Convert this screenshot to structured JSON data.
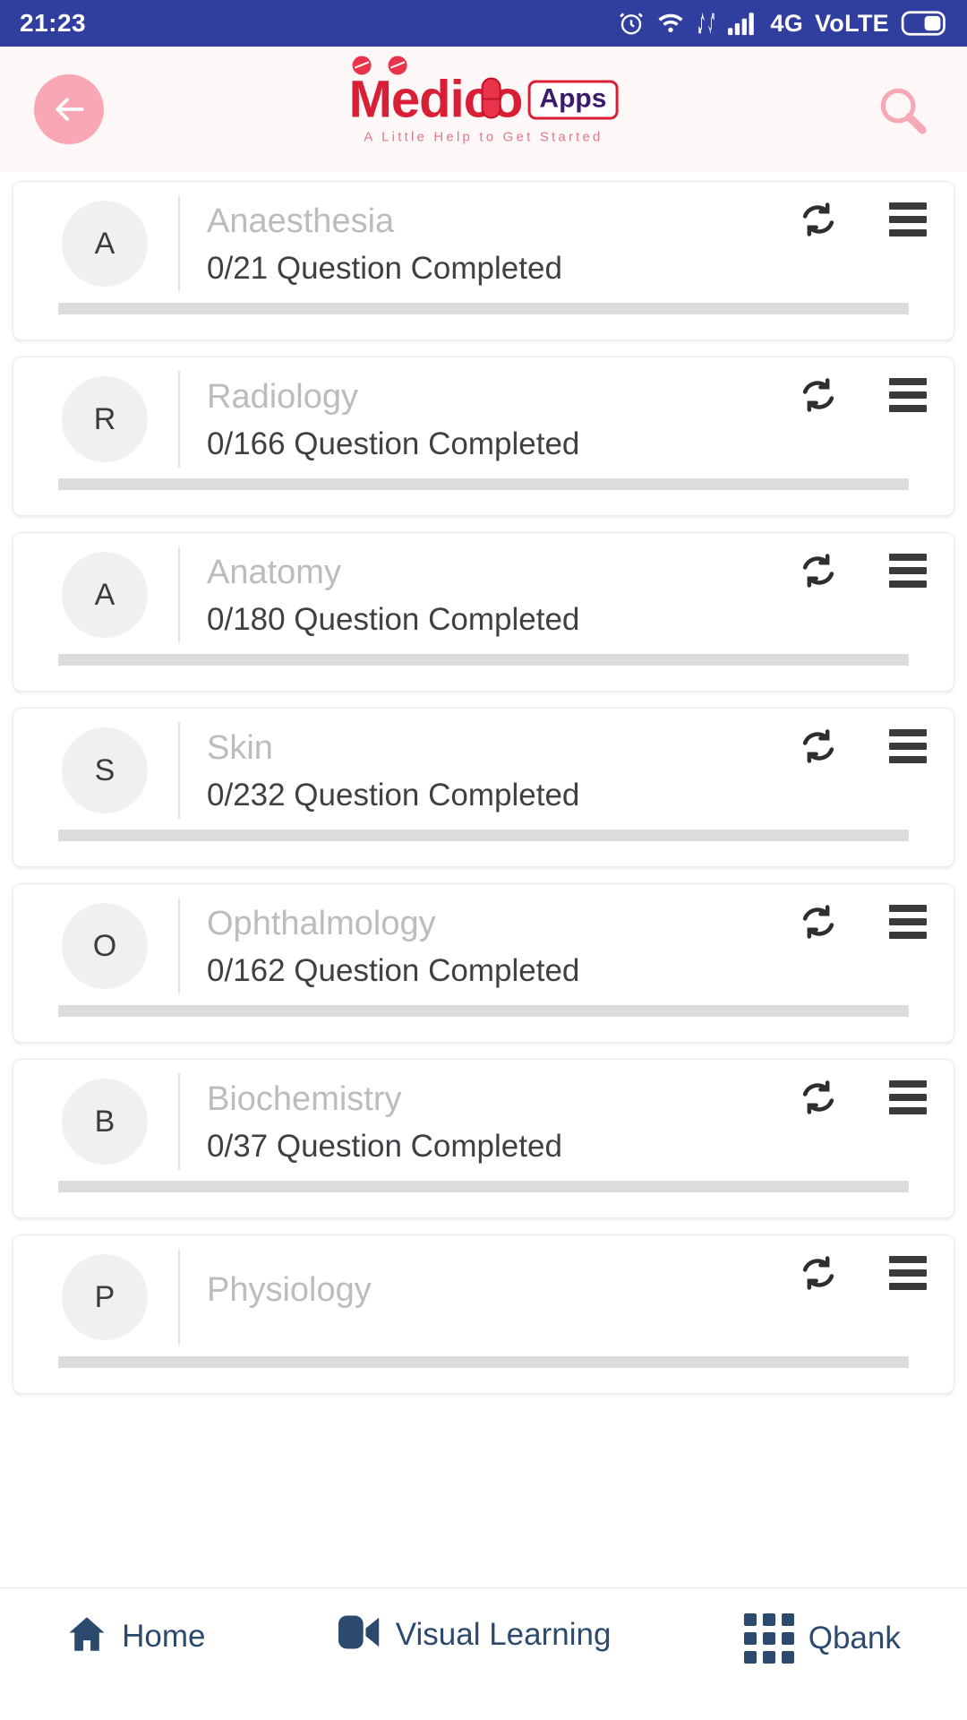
{
  "status_bar": {
    "time": "21:23",
    "network_label": "4G",
    "volte_label": "VoLTE",
    "icons": [
      "alarm-icon",
      "wifi-icon",
      "data-transfer-icon",
      "signal-icon",
      "battery-icon"
    ]
  },
  "header": {
    "back_label": "back-arrow",
    "logo": {
      "brand": "Medico",
      "badge": "Apps",
      "tagline": "A Little Help to Get Started",
      "brand_color": "#d81f35",
      "badge_color": "#3b1b6e",
      "tagline_color": "#e0788a"
    },
    "search_label": "search",
    "background": "#fdf7f8",
    "back_button_color": "#f9a7b4"
  },
  "subjects": [
    {
      "initial": "A",
      "title": "Anaesthesia",
      "progress_text": "0/21 Question Completed",
      "completed": 0,
      "total": 21,
      "percent": 0
    },
    {
      "initial": "R",
      "title": "Radiology",
      "progress_text": "0/166 Question Completed",
      "completed": 0,
      "total": 166,
      "percent": 0
    },
    {
      "initial": "A",
      "title": "Anatomy",
      "progress_text": "0/180 Question Completed",
      "completed": 0,
      "total": 180,
      "percent": 0
    },
    {
      "initial": "S",
      "title": "Skin",
      "progress_text": "0/232 Question Completed",
      "completed": 0,
      "total": 232,
      "percent": 0
    },
    {
      "initial": "O",
      "title": "Ophthalmology",
      "progress_text": "0/162 Question Completed",
      "completed": 0,
      "total": 162,
      "percent": 0
    },
    {
      "initial": "B",
      "title": "Biochemistry",
      "progress_text": "0/37 Question Completed",
      "completed": 0,
      "total": 37,
      "percent": 0
    },
    {
      "initial": "P",
      "title": "Physiology",
      "progress_text": "",
      "completed": 0,
      "total": 0,
      "percent": 0
    }
  ],
  "card_icons": {
    "refresh": "refresh-icon",
    "menu": "hamburger-menu-icon"
  },
  "bottom_nav": [
    {
      "label": "Home",
      "icon": "home-icon"
    },
    {
      "label": "Visual Learning",
      "icon": "video-camera-icon"
    },
    {
      "label": "Qbank",
      "icon": "grid-icon"
    }
  ]
}
